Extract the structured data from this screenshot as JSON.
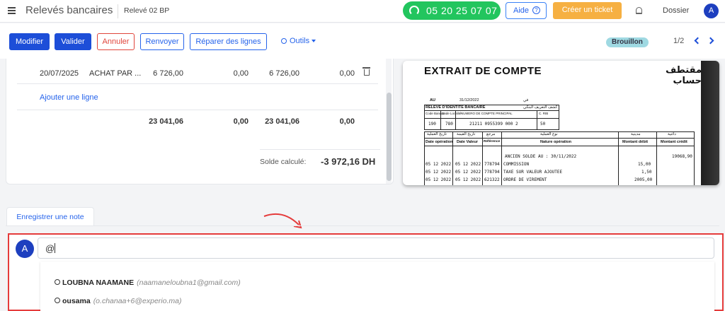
{
  "header": {
    "app_title": "Relevés bancaires",
    "breadcrumb": "Relevé 02 BP",
    "phone": "05 20 25 07 07",
    "help_label": "Aide",
    "help_icon": "?",
    "ticket_label": "Créer un ticket",
    "folder_label": "Dossier",
    "avatar_initial": "A"
  },
  "toolbar": {
    "modifier": "Modifier",
    "valider": "Valider",
    "annuler": "Annuler",
    "renvoyer": "Renvoyer",
    "reparer": "Réparer des lignes",
    "outils": "Outils",
    "status": "Brouillon",
    "pager": "1/2"
  },
  "lines": {
    "row": {
      "date": "20/07/2025",
      "label": "ACHAT PAR ...",
      "debit": "6 726,00",
      "credit": "0,00",
      "amount": "6 726,00",
      "balance": "0,00"
    },
    "add_line": "Ajouter une ligne",
    "totals": {
      "debit": "23 041,06",
      "credit": "0,00",
      "amount": "23 041,06",
      "balance": "0,00"
    },
    "solde_label": "Solde calculé:",
    "solde_value": "-3 972,16 DH"
  },
  "document": {
    "title": "EXTRAIT DE COMPTE",
    "title_ar": "مقتطف حساب",
    "au_label": "AU",
    "au_date": "31/12/2022",
    "au_ar": "في",
    "rib_label": "RELEVE D'IDENTITE BANCAIRE",
    "rib_ar": "كشف التعريف البنكي",
    "rib_headers": [
      "Code Banque",
      "Code Localité",
      "NUMERO DE COMPTE PRINCIPAL",
      "C. RIB"
    ],
    "rib_values": [
      "190",
      "780",
      "21211 0955399 000 2",
      "50"
    ],
    "col_ar": [
      "تاريخ العملية",
      "تاريخ القيمة",
      "مرجع",
      "نوع العملية",
      "مدينية",
      "دائنية"
    ],
    "col_fr": [
      "Date opération",
      "Date Valeur",
      "Référence",
      "Nature opération",
      "Montant débit",
      "Montant crédit"
    ],
    "rows": [
      {
        "date": "",
        "valeur": "",
        "ref": "",
        "nature": "ANCIEN  SOLDE AU : 30/11/2022",
        "debit": "",
        "credit": "19068,90"
      },
      {
        "date": "05 12 2022",
        "valeur": "05 12 2022",
        "ref": "778794",
        "nature": "COMMISSION",
        "debit": "15,00",
        "credit": ""
      },
      {
        "date": "05 12 2022",
        "valeur": "05 12 2022",
        "ref": "778794",
        "nature": "TAXE SUR VALEUR AJOUTEE",
        "debit": "1,50",
        "credit": ""
      },
      {
        "date": "05 12 2022",
        "valeur": "05 12 2022",
        "ref": "621322",
        "nature": "ORDRE DE VIREMENT",
        "debit": "2005,00",
        "credit": ""
      }
    ]
  },
  "note": {
    "tab_label": "Enregistrer une note",
    "avatar_initial": "A",
    "input_value": "@",
    "suggestions": [
      {
        "name": "LOUBNA NAAMANE",
        "email": "(naamaneloubna1@gmail.com)"
      },
      {
        "name": "ousama",
        "email": "(o.chanaa+6@experio.ma)"
      }
    ]
  },
  "colors": {
    "primary": "#1d4ed8",
    "success": "#22c55e",
    "warning": "#f6b042",
    "danger": "#e0453b",
    "annotation": "#e53b3b"
  }
}
